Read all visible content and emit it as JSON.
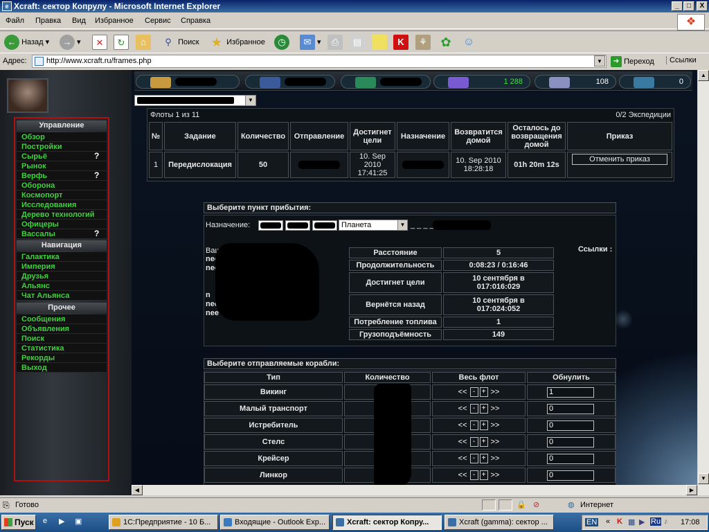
{
  "window": {
    "title": "Xcraft: сектор Копрулу - Microsoft Internet Explorer",
    "app_icon": "ie-icon",
    "min": "_",
    "max": "□",
    "close": "X"
  },
  "menu": [
    "Файл",
    "Правка",
    "Вид",
    "Избранное",
    "Сервис",
    "Справка"
  ],
  "toolbar": {
    "back": "Назад",
    "search": "Поиск",
    "favorites": "Избранное"
  },
  "address": {
    "label": "Адрес:",
    "url": "http://www.xcraft.ru/frames.php",
    "go": "Переход",
    "links": "Ссылки"
  },
  "resources": [
    {
      "value": "",
      "color": "#c89a40"
    },
    {
      "value": "",
      "color": "#3a5a9a"
    },
    {
      "value": "",
      "color": "#2a8a5a"
    },
    {
      "value": "1 288",
      "color": "#7a5ad0"
    },
    {
      "value": "108",
      "color": "#8a90c0"
    },
    {
      "value": "0",
      "color": "#3a7aa0"
    }
  ],
  "nav": {
    "manage_header": "Управление",
    "manage": [
      {
        "label": "Обзор",
        "q": ""
      },
      {
        "label": "Постройки",
        "q": ""
      },
      {
        "label": "Сырьё",
        "q": "?"
      },
      {
        "label": "Рынок",
        "q": ""
      },
      {
        "label": "Верфь",
        "q": "?"
      },
      {
        "label": "Оборона",
        "q": ""
      },
      {
        "label": "Космопорт",
        "q": ""
      },
      {
        "label": "Исследования",
        "q": ""
      },
      {
        "label": "Дерево технологий",
        "q": ""
      },
      {
        "label": "Офицеры",
        "q": ""
      },
      {
        "label": "Вассалы",
        "q": "?"
      }
    ],
    "nav_header": "Навигация",
    "navigation": [
      "Галактика",
      "Империя",
      "Друзья",
      "Альянс",
      "Чат Альянса"
    ],
    "other_header": "Прочее",
    "other": [
      "Сообщения",
      "Объявления",
      "Поиск",
      "Статистика",
      "Рекорды",
      "Выход"
    ]
  },
  "fleets": {
    "summary": "Флоты 1 из 11",
    "expeditions": "0/2 Экспедиции",
    "headers": [
      "№",
      "Задание",
      "Количество",
      "Отправление",
      "Достигнет цели",
      "Назначение",
      "Возвратится домой",
      "Осталось до возвращения домой",
      "Приказ"
    ],
    "row": {
      "num": "1",
      "mission": "Передислокация",
      "count": "50",
      "arrive": "10. Sep 2010 17:41:25",
      "return": "10. Sep 2010 18:28:18",
      "remaining": "01h 20m 12s",
      "action": "Отменить приказ"
    }
  },
  "arrival": {
    "header": "Выберите пункт прибытия:",
    "dest_label": "Назначение:",
    "planet_type": "Планета",
    "dest_name": "_ _ _ _ _",
    "my_planets_label": "Ваши планеты:",
    "planets": [
      "need",
      "need",
      "",
      "",
      "n",
      "nee",
      "nee"
    ],
    "links_label": "Ссылки :",
    "info": [
      {
        "label": "Расстояние",
        "value": "5",
        "style": "white"
      },
      {
        "label": "Продолжительность",
        "value": "0:08:23 / 0:16:46",
        "style": "white"
      },
      {
        "label": "Достигнет цели",
        "value": "10 сентября в 017:016:029",
        "style": "lime"
      },
      {
        "label": "Вернётся назад",
        "value": "10 сентября в 017:024:052",
        "style": "lime"
      },
      {
        "label": "Потребление топлива",
        "value": "1",
        "style": "green"
      },
      {
        "label": "Грузоподъёмность",
        "value": "149",
        "style": "green"
      }
    ]
  },
  "ships": {
    "header": "Выберите отправляемые корабли:",
    "cols": [
      "Тип",
      "Количество",
      "Весь флот",
      "Обнулить"
    ],
    "ctrl": {
      "left": "<<",
      "minus": "-",
      "plus": "+",
      "right": ">>"
    },
    "rows": [
      {
        "name": "Викинг",
        "value": "1"
      },
      {
        "name": "Малый транспорт",
        "value": "0"
      },
      {
        "name": "Истребитель",
        "value": "0"
      },
      {
        "name": "Стелс",
        "value": "0"
      },
      {
        "name": "Крейсер",
        "value": "0"
      },
      {
        "name": "Линкор",
        "value": "0"
      }
    ]
  },
  "status": {
    "text": "Готово",
    "zone": "Интернет"
  },
  "taskbar": {
    "start": "Пуск",
    "tasks": [
      {
        "label": "1С:Предприятие - 10 Б...",
        "color": "#e0a020"
      },
      {
        "label": "Входящие - Outlook Exp...",
        "color": "#3a7ac0"
      },
      {
        "label": "Xcraft: сектор Копру...",
        "color": "#3a6ea5"
      },
      {
        "label": "Xcraft (gamma): сектор ...",
        "color": "#3a6ea5"
      }
    ],
    "lang": "EN",
    "tray_lang": "Ru",
    "clock": "17:08"
  }
}
